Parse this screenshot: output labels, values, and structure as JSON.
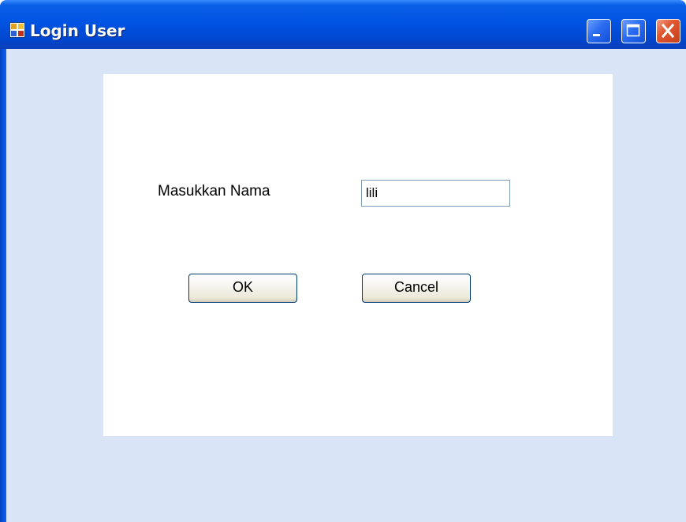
{
  "window": {
    "title": "Login User",
    "icon": "app-window-icon",
    "controls": {
      "minimize_icon": "minimize-icon",
      "maximize_icon": "maximize-icon",
      "close_icon": "close-icon"
    }
  },
  "form": {
    "name_label": "Masukkan Nama",
    "name_value": "lili",
    "ok_label": "OK",
    "cancel_label": "Cancel"
  },
  "colors": {
    "titlebar": "#0054e3",
    "client_background": "#d9e4f6",
    "panel_background": "#ffffff",
    "close_button": "#e0572f"
  }
}
